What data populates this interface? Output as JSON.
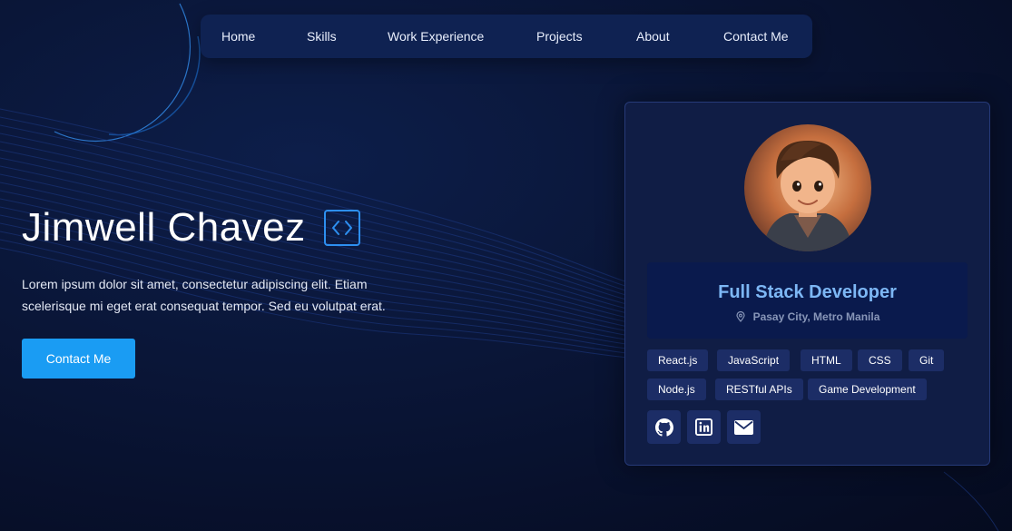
{
  "nav": {
    "items": [
      {
        "label": "Home"
      },
      {
        "label": "Skills"
      },
      {
        "label": "Work Experience"
      },
      {
        "label": "Projects"
      },
      {
        "label": "About"
      },
      {
        "label": "Contact Me"
      }
    ]
  },
  "hero": {
    "name": "Jimwell Chavez",
    "name_icon": "code-icon",
    "description": "Lorem ipsum dolor sit amet, consectetur adipiscing elit. Etiam scelerisque mi eget erat consequat tempor. Sed eu volutpat erat.",
    "cta_label": "Contact Me"
  },
  "profile": {
    "avatar_alt": "avatar",
    "role": "Full Stack Developer",
    "location": "Pasay City, Metro Manila",
    "location_icon": "location-pin-icon",
    "skills": [
      "React.js",
      "JavaScript",
      "HTML",
      "CSS",
      "Git",
      "Node.js",
      "RESTful APIs",
      "Game Development"
    ],
    "socials": [
      {
        "icon": "github-icon"
      },
      {
        "icon": "linkedin-icon"
      },
      {
        "icon": "email-icon"
      }
    ]
  },
  "colors": {
    "background": "#070f29",
    "accent": "#1a9cf3",
    "role_text": "#7db7f5",
    "card": "#101d45",
    "chip": "#1c2d66"
  }
}
